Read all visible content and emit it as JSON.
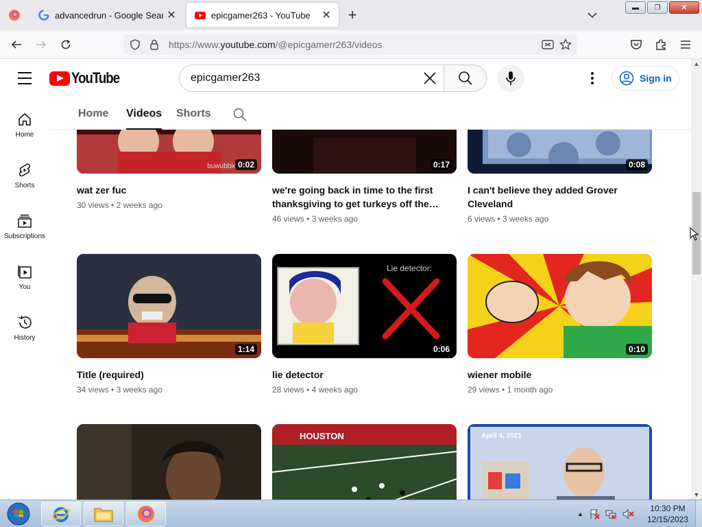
{
  "browser": {
    "tabs": [
      {
        "title": "advancedrun - Google Search",
        "icon": "google-g-icon",
        "active": false
      },
      {
        "title": "epicgamer263 - YouTube",
        "icon": "youtube-icon",
        "active": true
      }
    ],
    "url_prefix": "https://www.",
    "url_domain": "youtube.com",
    "url_path": "/@epicgamerr263/videos"
  },
  "youtube": {
    "logo_text": "YouTube",
    "search_value": "epicgamer263",
    "sign_in_label": "Sign in",
    "guide": [
      {
        "label": "Home",
        "icon": "home-icon"
      },
      {
        "label": "Shorts",
        "icon": "shorts-icon"
      },
      {
        "label": "Subscriptions",
        "icon": "subscriptions-icon"
      },
      {
        "label": "You",
        "icon": "you-icon"
      },
      {
        "label": "History",
        "icon": "history-icon"
      }
    ],
    "channel_tabs": [
      {
        "label": "Home",
        "selected": false
      },
      {
        "label": "Videos",
        "selected": true
      },
      {
        "label": "Shorts",
        "selected": false
      }
    ],
    "videos": [
      {
        "title": "wat zer fuc",
        "views": "30 views",
        "age": "2 weeks ago",
        "duration": "0:02",
        "overlay_text": "buwubble"
      },
      {
        "title": "we're going back in time to the first thanksgiving to get turkeys off the…",
        "views": "46 views",
        "age": "3 weeks ago",
        "duration": "0:17"
      },
      {
        "title": "I can't believe they added Grover Cleveland",
        "views": "6 views",
        "age": "3 weeks ago",
        "duration": "0:08"
      },
      {
        "title": "Title (required)",
        "views": "34 views",
        "age": "3 weeks ago",
        "duration": "1:14"
      },
      {
        "title": "lie detector",
        "views": "28 views",
        "age": "4 weeks ago",
        "duration": "0:06",
        "overlay_text": "Lie detector:"
      },
      {
        "title": "wiener mobile",
        "views": "29 views",
        "age": "1 month ago",
        "duration": "0:10"
      },
      {
        "title": "",
        "views": "",
        "age": "",
        "duration": ""
      },
      {
        "title": "",
        "views": "",
        "age": "",
        "duration": "",
        "overlay_text": "HOUSTON"
      },
      {
        "title": "",
        "views": "",
        "age": "",
        "duration": "",
        "overlay_text": "April 4, 2021"
      }
    ]
  },
  "taskbar": {
    "time": "10:30 PM",
    "date": "12/15/2023"
  },
  "colors": {
    "yt_red": "#ff0000",
    "sign_in_blue": "#065fd4",
    "meta_gray": "#606060"
  }
}
